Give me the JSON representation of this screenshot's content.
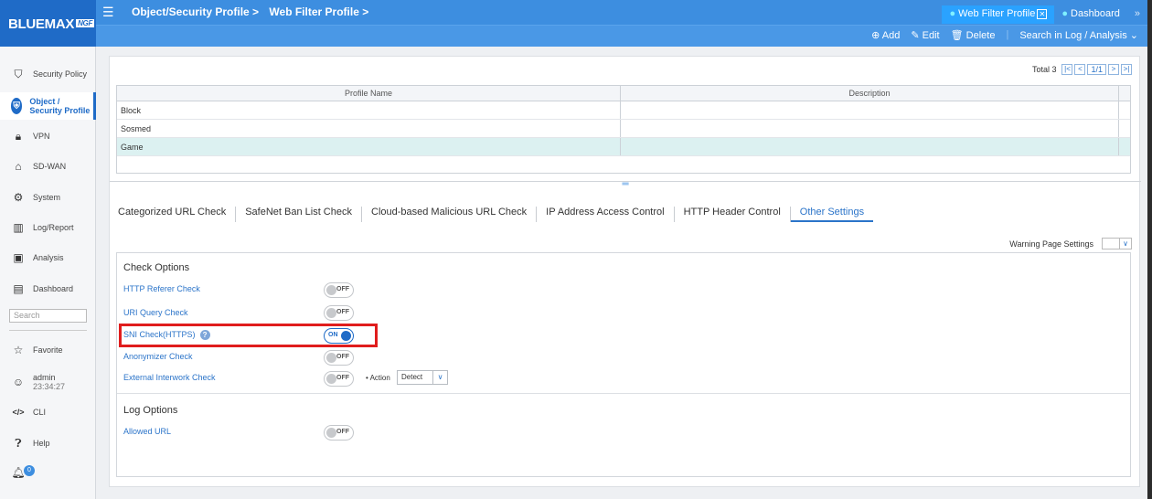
{
  "header": {
    "brand": "BLUEMAX",
    "brand_suffix": "NGF",
    "breadcrumb": [
      "Object/Security Profile >",
      "Web Filter Profile >"
    ],
    "tabs": [
      {
        "label": "Web Filter Profile",
        "active": true
      },
      {
        "label": "Dashboard",
        "active": false
      }
    ],
    "tab_more": "»",
    "actions": {
      "add": "⊕ Add",
      "edit": "✎ Edit",
      "delete": "🗑 Delete",
      "search": "Search in Log / Analysis ⌄"
    }
  },
  "sidebar": {
    "items": [
      {
        "label": "Security Policy",
        "icon": "shield-icon"
      },
      {
        "label": "Object / Security Profile",
        "icon": "object-profile-icon",
        "active": true
      },
      {
        "label": "VPN",
        "icon": "lock-icon"
      },
      {
        "label": "SD-WAN",
        "icon": "network-icon"
      },
      {
        "label": "System",
        "icon": "gear-icon"
      },
      {
        "label": "Log/Report",
        "icon": "chart-icon"
      },
      {
        "label": "Analysis",
        "icon": "monitor-icon"
      },
      {
        "label": "Dashboard",
        "icon": "dashboard-icon"
      }
    ],
    "search_placeholder": "Search",
    "favorite": "Favorite",
    "admin": "admin",
    "admin_time": "23:34:27",
    "cli": "CLI",
    "help": "Help",
    "notifications": "0"
  },
  "pager": {
    "total_label": "Total",
    "total": "3",
    "page": "1/1"
  },
  "grid": {
    "headers": [
      "Profile Name",
      "Description"
    ],
    "rows": [
      {
        "name": "Block",
        "description": ""
      },
      {
        "name": "Sosmed",
        "description": ""
      },
      {
        "name": "Game",
        "description": "",
        "selected": true
      }
    ]
  },
  "profile_tabs": [
    "Categorized URL Check",
    "SafeNet Ban List Check",
    "Cloud-based Malicious URL Check",
    "IP Address Access Control",
    "HTTP Header Control",
    "Other Settings"
  ],
  "active_tab": "Other Settings",
  "warning_settings": "Warning Page Settings",
  "check_options": {
    "title": "Check Options",
    "items": [
      {
        "label": "HTTP Referer Check",
        "state": "OFF"
      },
      {
        "label": "URI Query Check",
        "state": "OFF"
      },
      {
        "label": "SNI Check(HTTPS)",
        "state": "ON"
      },
      {
        "label": "Anonymizer Check",
        "state": "OFF"
      },
      {
        "label": "External Interwork Check",
        "state": "OFF"
      }
    ],
    "action_label": "• Action",
    "action_value": "Detect"
  },
  "log_options": {
    "title": "Log Options",
    "items": [
      {
        "label": "Allowed URL",
        "state": "OFF"
      }
    ]
  },
  "colors": {
    "brand": "#1f6bc7",
    "header": "#3d8ee0",
    "highlight": "#e01d1d"
  }
}
